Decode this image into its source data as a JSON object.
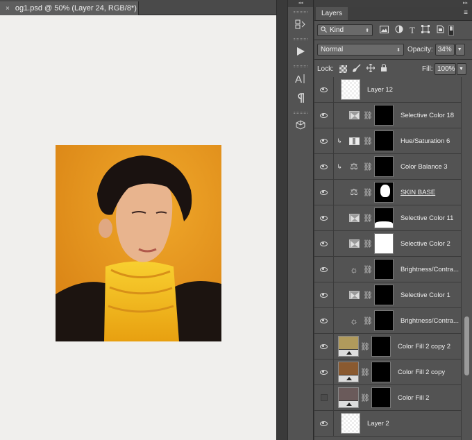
{
  "document": {
    "tab_close": "×",
    "tab_title": "og1.psd @ 50% (Layer 24, RGB/8*)"
  },
  "layers_panel": {
    "tab_label": "Layers",
    "filter_kind": "Kind",
    "blend_mode": "Normal",
    "opacity_label": "Opacity:",
    "opacity_value": "34%",
    "lock_label": "Lock:",
    "fill_label": "Fill:",
    "fill_value": "100%",
    "layers": [
      {
        "name": "Layer 12",
        "type": "pixel",
        "visible": true
      },
      {
        "name": "Selective Color 18",
        "type": "selective-color",
        "visible": true,
        "mask": "black"
      },
      {
        "name": "Hue/Saturation 6",
        "type": "hue-saturation",
        "visible": true,
        "clipped": true,
        "mask": "black"
      },
      {
        "name": "Color Balance 3",
        "type": "color-balance",
        "visible": true,
        "clipped": true,
        "mask": "black"
      },
      {
        "name": "SKIN BASE",
        "type": "color-balance",
        "visible": true,
        "mask": "silhouette"
      },
      {
        "name": "Selective Color 11",
        "type": "selective-color",
        "visible": true,
        "mask": "half"
      },
      {
        "name": "Selective Color 2",
        "type": "selective-color",
        "visible": true,
        "mask": "white"
      },
      {
        "name": "Brightness/Contra...",
        "type": "brightness-contrast",
        "visible": true,
        "mask": "black"
      },
      {
        "name": "Selective Color 1",
        "type": "selective-color",
        "visible": true,
        "mask": "black"
      },
      {
        "name": "Brightness/Contra...",
        "type": "brightness-contrast",
        "visible": true,
        "mask": "black"
      },
      {
        "name": "Color Fill 2 copy 2",
        "type": "color-fill",
        "visible": true,
        "fill": "#b09a5c",
        "mask": "black"
      },
      {
        "name": "Color Fill 2 copy",
        "type": "color-fill",
        "visible": true,
        "fill": "#8a5a30",
        "mask": "black"
      },
      {
        "name": "Color Fill 2",
        "type": "color-fill",
        "visible": false,
        "fill": "#6a5a5a",
        "mask": "black"
      },
      {
        "name": "Layer 2",
        "type": "pixel",
        "visible": true
      }
    ]
  }
}
